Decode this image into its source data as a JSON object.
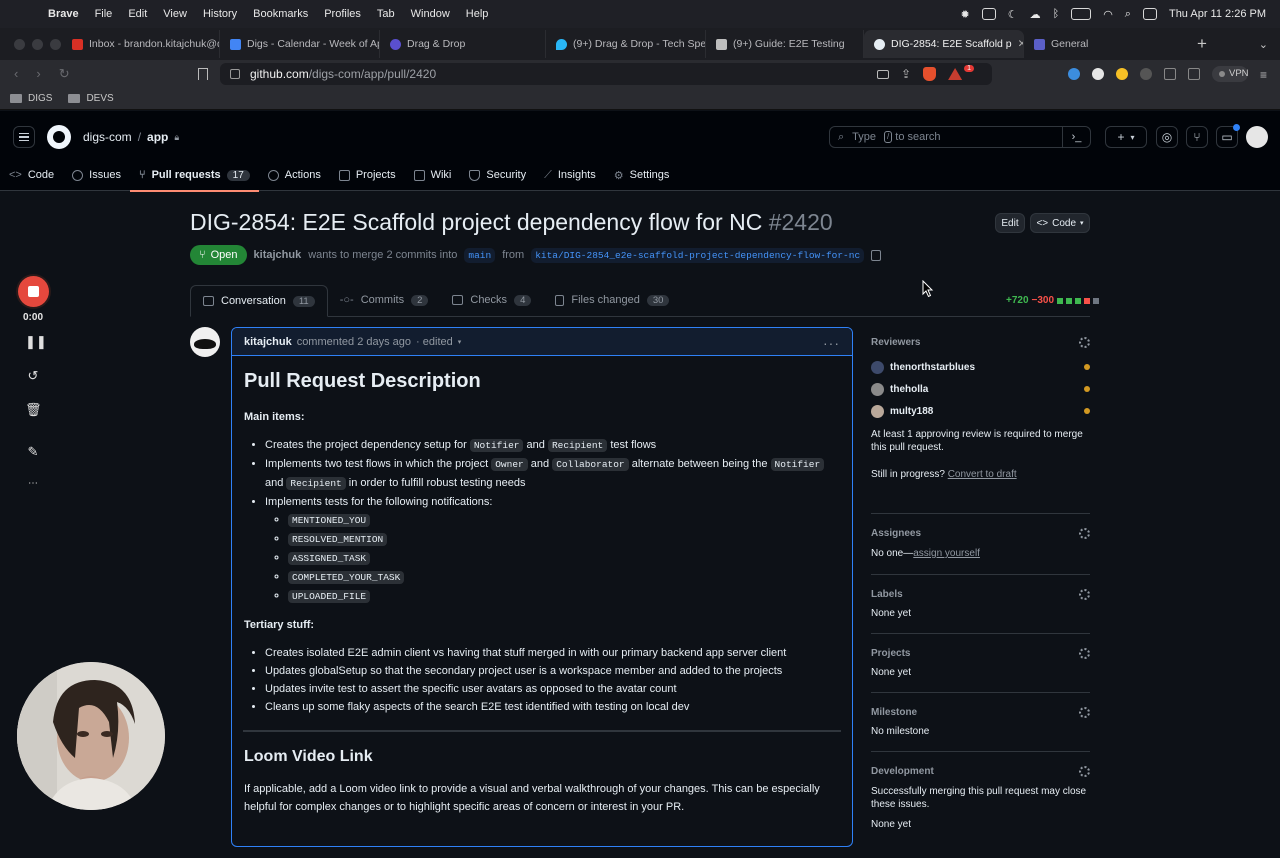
{
  "menubar": {
    "app": "Brave",
    "items": [
      "File",
      "Edit",
      "View",
      "History",
      "Bookmarks",
      "Profiles",
      "Tab",
      "Window",
      "Help"
    ],
    "datetime": "Thu Apr 11  2:26 PM"
  },
  "browser": {
    "tabs": [
      {
        "title": "Inbox - brandon.kitajchuk@dig",
        "icon": "gmail-icon",
        "color": "#d93025"
      },
      {
        "title": "Digs - Calendar - Week of Apr",
        "icon": "calendar-icon",
        "color": "#4285f4"
      },
      {
        "title": "Drag & Drop",
        "icon": "app-icon",
        "color": "#5a4fcf"
      },
      {
        "title": "(9+) Drag & Drop - Tech Spec",
        "icon": "drop-icon",
        "color": "#29b6f6"
      },
      {
        "title": "(9+) Guide: E2E Testing",
        "icon": "doc-icon",
        "color": "#bdbdbd"
      },
      {
        "title": "DIG-2854: E2E Scaffold p",
        "icon": "github-icon",
        "color": "#e6edf3",
        "active": true
      },
      {
        "title": "General",
        "icon": "teams-icon",
        "color": "#5b5fc7"
      }
    ],
    "url_host": "github.com",
    "url_path": "/digs-com/app/pull/2420",
    "rewards_badge": "1",
    "vpn_label": "VPN",
    "bookmarks": [
      "DIGS",
      "DEVS"
    ]
  },
  "github": {
    "owner": "digs-com",
    "repo": "app",
    "search_placeholder_pre": "Type",
    "search_key": "/",
    "search_placeholder_post": "to search",
    "nav": [
      {
        "label": "Code"
      },
      {
        "label": "Issues"
      },
      {
        "label": "Pull requests",
        "count": "17",
        "active": true
      },
      {
        "label": "Actions"
      },
      {
        "label": "Projects"
      },
      {
        "label": "Wiki"
      },
      {
        "label": "Security"
      },
      {
        "label": "Insights"
      },
      {
        "label": "Settings"
      }
    ]
  },
  "pr": {
    "title": "DIG-2854: E2E Scaffold project dependency flow for NC",
    "number": "#2420",
    "edit_label": "Edit",
    "code_label": "Code",
    "state": "Open",
    "author": "kitajchuk",
    "merge_text": "wants to merge 2 commits into",
    "base_branch": "main",
    "from_text": "from",
    "head_branch": "kita/DIG-2854_e2e-scaffold-project-dependency-flow-for-nc",
    "tabs": [
      {
        "label": "Conversation",
        "count": "11",
        "active": true
      },
      {
        "label": "Commits",
        "count": "2"
      },
      {
        "label": "Checks",
        "count": "4"
      },
      {
        "label": "Files changed",
        "count": "30"
      }
    ],
    "additions": "+720",
    "deletions": "−300",
    "diff_blocks": [
      "#3fb950",
      "#3fb950",
      "#3fb950",
      "#f85149",
      "#6e7681"
    ]
  },
  "comment": {
    "author": "kitajchuk",
    "meta": "commented 2 days ago",
    "edited": "· edited",
    "heading": "Pull Request Description",
    "main_label": "Main items:",
    "item1_a": "Creates the project dependency setup for",
    "item1_code1": "Notifier",
    "item1_b": "and",
    "item1_code2": "Recipient",
    "item1_c": "test flows",
    "item2_a": "Implements two test flows in which the project",
    "item2_code1": "Owner",
    "item2_b": "and",
    "item2_code2": "Collaborator",
    "item2_c": "alternate between being the",
    "item2_code3": "Notifier",
    "item2_d": "and",
    "item2_code4": "Recipient",
    "item2_e": "in order to fulfill robust testing needs",
    "item3": "Implements tests for the following notifications:",
    "notifications": [
      "MENTIONED_YOU",
      "RESOLVED_MENTION",
      "ASSIGNED_TASK",
      "COMPLETED_YOUR_TASK",
      "UPLOADED_FILE"
    ],
    "tertiary_label": "Tertiary stuff:",
    "tertiary": [
      "Creates isolated E2E admin client vs having that stuff merged in with our primary backend app server client",
      "Updates globalSetup so that the secondary project user is a workspace member and added to the projects",
      "Updates invite test to assert the specific user avatars as opposed to the avatar count",
      "Cleans up some flaky aspects of the search E2E test identified with testing on local dev"
    ],
    "loom_heading": "Loom Video Link",
    "loom_text": "If applicable, add a Loom video link to provide a visual and verbal walkthrough of your changes. This can be especially helpful for complex changes or to highlight specific areas of concern or interest in your PR."
  },
  "sidebar": {
    "reviewers_label": "Reviewers",
    "reviewers": [
      "thenorthstarblues",
      "theholla",
      "multy188"
    ],
    "review_note": "At least 1 approving review is required to merge this pull request.",
    "progress_q": "Still in progress?",
    "convert_link": "Convert to draft",
    "assignees_label": "Assignees",
    "assignees_value": "No one—",
    "assign_link": "assign yourself",
    "labels_label": "Labels",
    "labels_value": "None yet",
    "projects_label": "Projects",
    "projects_value": "None yet",
    "milestone_label": "Milestone",
    "milestone_value": "No milestone",
    "development_label": "Development",
    "development_note": "Successfully merging this pull request may close these issues.",
    "development_value": "None yet"
  },
  "loom": {
    "timer": "0:00"
  }
}
